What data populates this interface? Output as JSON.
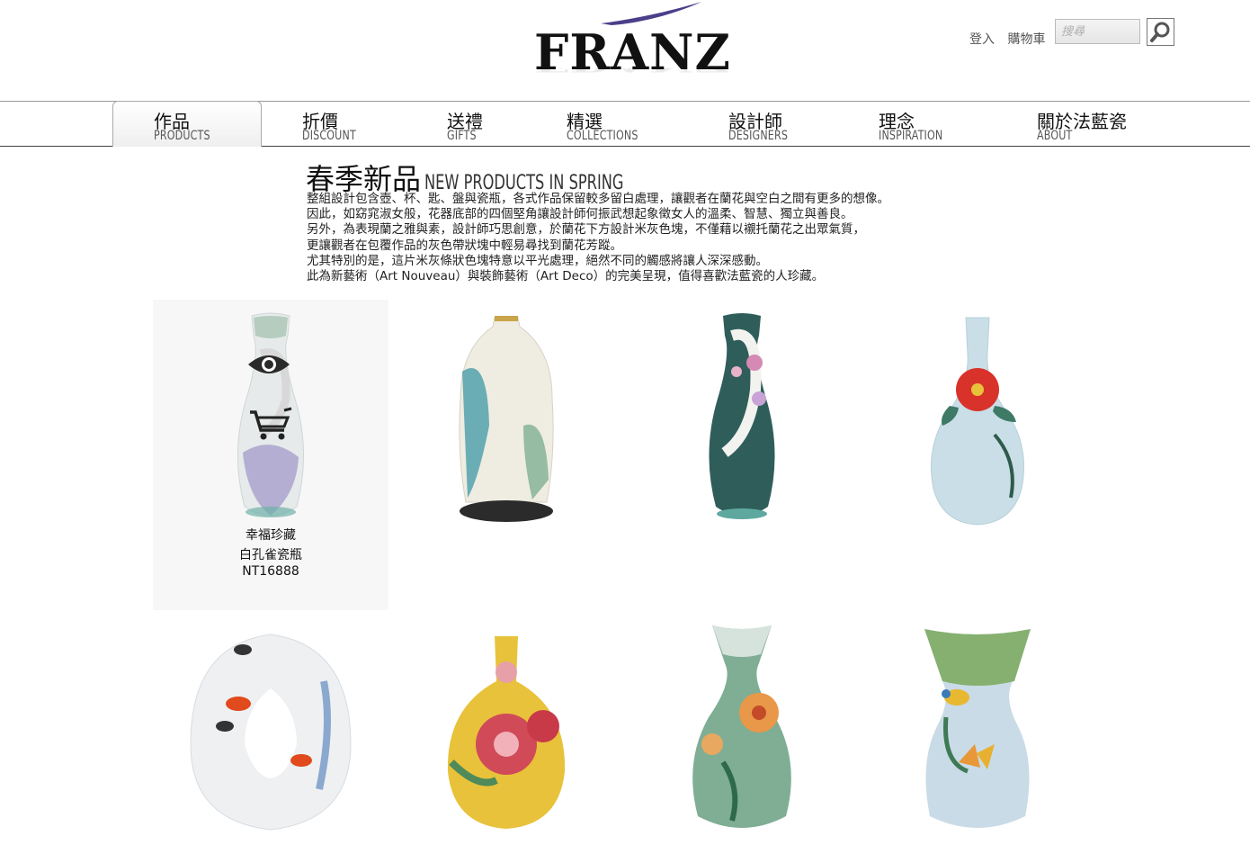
{
  "header": {
    "logo_text": "FRANZ",
    "login_label": "登入",
    "cart_label": "購物車",
    "search_placeholder": "搜尋",
    "search_icon": "magnifier-icon"
  },
  "nav": [
    {
      "zh": "作品",
      "en": "PRODUCTS",
      "active": true
    },
    {
      "zh": "折價",
      "en": "DISCOUNT"
    },
    {
      "zh": "送禮",
      "en": "GIFTS"
    },
    {
      "zh": "精選",
      "en": "COLLECTIONS"
    },
    {
      "zh": "設計師",
      "en": "DESIGNERS"
    },
    {
      "zh": "理念",
      "en": "INSPIRATION"
    },
    {
      "zh": "關於法藍瓷",
      "en": "ABOUT"
    }
  ],
  "intro": {
    "title_zh": "春季新品",
    "title_en": "NEW PRODUCTS IN SPRING",
    "lines": [
      "整組設計包含壺、杯、匙、盤與瓷瓶，各式作品保留較多留白處理，讓觀者在蘭花與空白之間有更多的想像。",
      "因此，如窈窕淑女般，花器底部的四個堅角讓設計師何振武想起象徵女人的溫柔、智慧、獨立與善良。",
      "另外，為表現蘭之雅與素，設計師巧思創意，於蘭花下方設計米灰色塊，不僅藉以襯托蘭花之出眾氣質，",
      "更讓觀者在包覆作品的灰色帶狀塊中輕易尋找到蘭花芳蹤。",
      "尤其特別的是，這片米灰條狀色塊特意以平光處理，絕然不同的觸感將讓人深深感動。",
      "此為新藝術（Art Nouveau）與裝飾藝術（Art Deco）的完美呈現，值得喜歡法藍瓷的人珍藏。"
    ]
  },
  "hover_actions": {
    "view_icon": "eye-icon",
    "cart_icon": "shopping-cart-icon"
  },
  "products": [
    {
      "name": "peacock-plum-vase",
      "caption_line1": "幸福珍藏",
      "caption_line2": "白孔雀瓷瓶",
      "price": "NT16888",
      "colors": {
        "body": "#e8ecec",
        "accent": "#8a7fb8",
        "top": "#9bb8a8"
      }
    },
    {
      "name": "landscape-vase",
      "colors": {
        "body": "#eeece4",
        "accent": "#3e9aa8",
        "top": "#d8c9a6"
      }
    },
    {
      "name": "peacock-teal-vase",
      "colors": {
        "body": "#2f5e5a",
        "accent": "#c78ab3",
        "top": "#1f4a46"
      }
    },
    {
      "name": "red-camellia-vase",
      "colors": {
        "body": "#c8dde6",
        "accent": "#d8322a",
        "top": "#bcd6e0"
      }
    },
    {
      "name": "goldfish-ring-vase",
      "colors": {
        "body": "#eef0f2",
        "accent": "#e04a1c",
        "top": "#dde6ee"
      }
    },
    {
      "name": "peony-yellow-vase",
      "colors": {
        "body": "#e8c23a",
        "accent": "#d04a58",
        "top": "#e6b830"
      }
    },
    {
      "name": "peony-green-vase",
      "colors": {
        "body": "#7fae94",
        "accent": "#e89848",
        "top": "#c6d8cc"
      }
    },
    {
      "name": "bird-butterfly-vase",
      "colors": {
        "body": "#c9dbe6",
        "accent": "#6ea64a",
        "top": "#86b070"
      }
    }
  ]
}
